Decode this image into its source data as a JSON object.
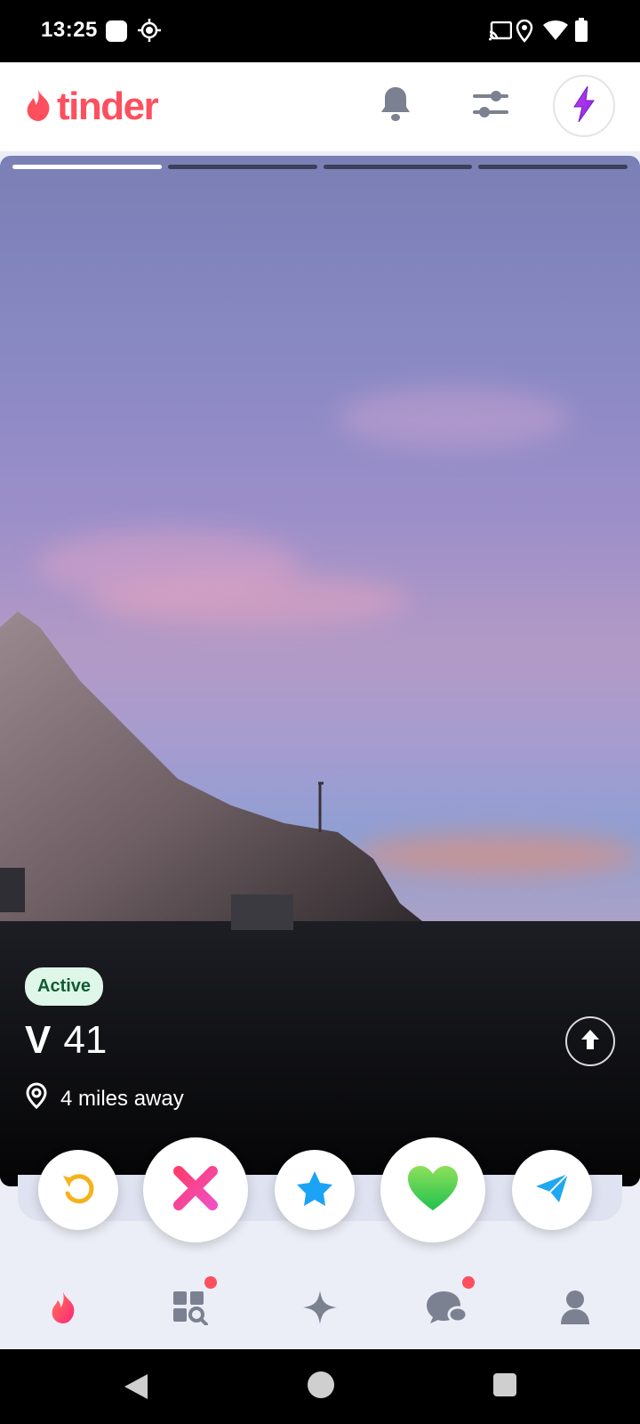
{
  "status": {
    "time": "13:25",
    "icons": [
      "media-icon",
      "gps-icon",
      "cast-icon",
      "location-icon",
      "wifi-icon",
      "battery-icon"
    ]
  },
  "header": {
    "brand": "tinder",
    "brand_color": "#fd4f5e",
    "icons": [
      "bell-icon",
      "filter-sliders-icon",
      "boost-lightning-icon"
    ]
  },
  "card": {
    "photo_count": 4,
    "current_photo": 1,
    "status_badge": "Active",
    "name": "V",
    "age": "41",
    "distance": "4 miles away"
  },
  "actions": [
    {
      "name": "rewind",
      "icon": "rewind-icon",
      "color": "#f5b21b"
    },
    {
      "name": "nope",
      "icon": "x-icon",
      "color": "#fd3c6e"
    },
    {
      "name": "super-like",
      "icon": "star-icon",
      "color": "#1ba3f5"
    },
    {
      "name": "like",
      "icon": "heart-icon",
      "color": "#4cd45a"
    },
    {
      "name": "boost-send",
      "icon": "paper-plane-icon",
      "color": "#1fa7ef"
    }
  ],
  "tabs": [
    {
      "name": "discover",
      "icon": "flame-icon",
      "active": true
    },
    {
      "name": "explore",
      "icon": "grid-search-icon",
      "badge": true
    },
    {
      "name": "gold",
      "icon": "sparkle-icon"
    },
    {
      "name": "matches",
      "icon": "chat-icon",
      "badge": true
    },
    {
      "name": "profile",
      "icon": "user-icon"
    }
  ]
}
